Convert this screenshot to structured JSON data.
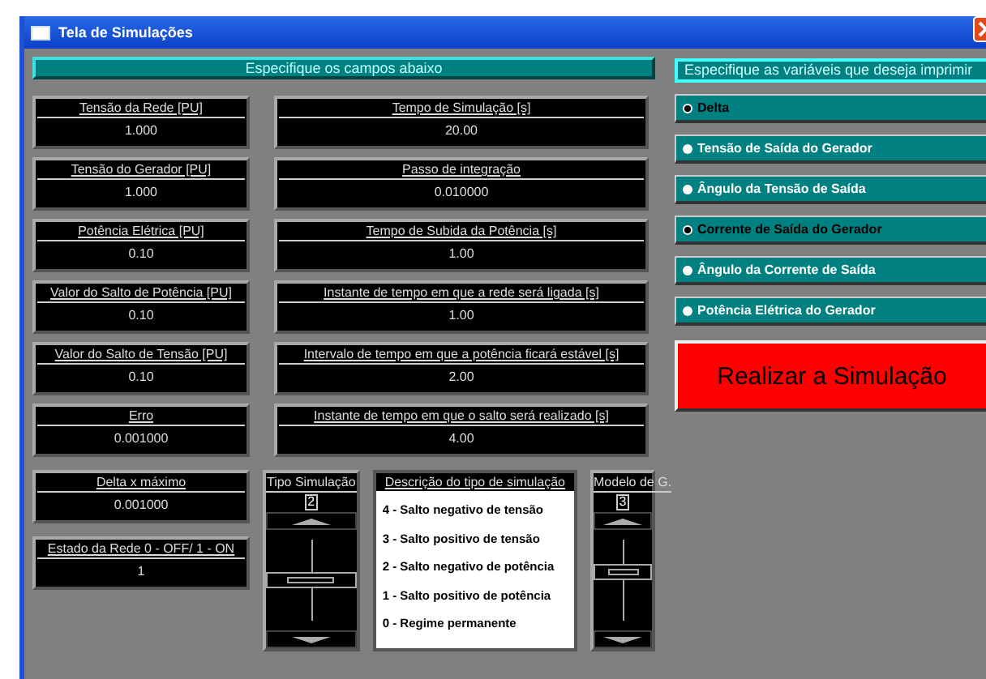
{
  "window": {
    "title": "Tela de Simulações"
  },
  "fields_header": "Especifique os campos abaixo",
  "left_fields": [
    {
      "label": "Tensão da Rede [PU]",
      "value": "1.000"
    },
    {
      "label": "Tensão do Gerador [PU]",
      "value": "1.000"
    },
    {
      "label": "Potência Elétrica [PU]",
      "value": "0.10"
    },
    {
      "label": "Valor do Salto de Potência [PU]",
      "value": "0.10"
    },
    {
      "label": "Valor do Salto de Tensão [PU]",
      "value": "0.10"
    },
    {
      "label": "Erro",
      "value": "0.001000"
    }
  ],
  "right_fields": [
    {
      "label": "Tempo de Simulação [s]",
      "value": "20.00"
    },
    {
      "label": "Passo de integração",
      "value": "0.010000"
    },
    {
      "label": "Tempo de Subida da Potência [s]",
      "value": "1.00"
    },
    {
      "label": "Instante de tempo em que a rede será ligada [s]",
      "value": "1.00"
    },
    {
      "label": "Intervalo de tempo em que a potência ficará estável [s]",
      "value": "2.00"
    },
    {
      "label": "Instante de tempo em que o salto será realizado [s]",
      "value": "4.00"
    }
  ],
  "bottom_fields": [
    {
      "label": "Delta x máximo",
      "value": "0.001000"
    },
    {
      "label": "Estado da Rede 0 - OFF/ 1 - ON",
      "value": "1"
    }
  ],
  "sliders": [
    {
      "label": "Tipo Simulação",
      "value": "2"
    },
    {
      "label": "Modelo de G.",
      "value": "3"
    }
  ],
  "description": {
    "title": "Descrição do tipo de simulação",
    "lines": [
      "4 - Salto negativo de tensão",
      "3 - Salto positivo de tensão",
      "2 - Salto negativo de potência",
      "1 - Salto positivo de potência",
      "0 - Regime permanente"
    ]
  },
  "print_header": "Especifique as variáveis que deseja imprimir",
  "print_options": [
    {
      "label": "Delta",
      "selected": true
    },
    {
      "label": "Tensão de Saída do Gerador",
      "selected": false
    },
    {
      "label": "Ângulo da Tensão de Saída",
      "selected": false
    },
    {
      "label": "Corrente de Saída do Gerador",
      "selected": true
    },
    {
      "label": "Ângulo da Corrente de Saída",
      "selected": false
    },
    {
      "label": "Potência Elétrica do Gerador",
      "selected": false
    }
  ],
  "run_button": "Realizar a Simulação"
}
